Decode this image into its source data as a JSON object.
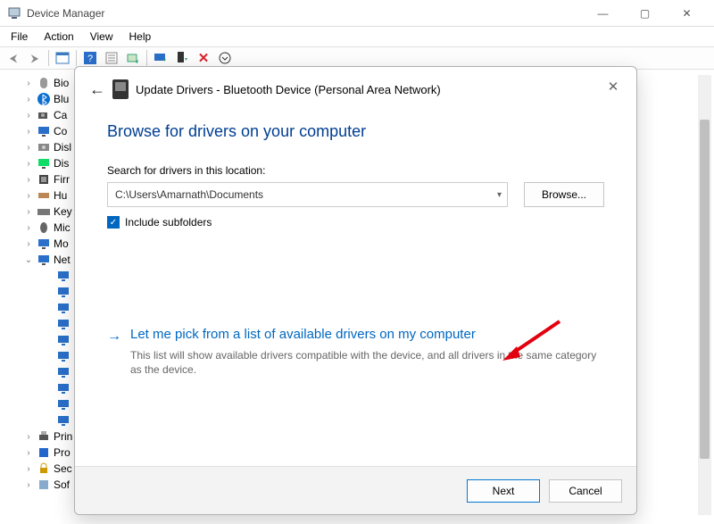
{
  "window": {
    "title": "Device Manager",
    "controls": {
      "min": "—",
      "max": "▢",
      "close": "✕"
    }
  },
  "menu": {
    "items": [
      "File",
      "Action",
      "View",
      "Help"
    ]
  },
  "toolbar": {
    "back": "←",
    "forward": "→",
    "icons": [
      "help",
      "props",
      "scan",
      "update",
      "monitor",
      "enable",
      "disable",
      "uninstall"
    ]
  },
  "tree": {
    "lvl1": [
      {
        "label": "Bio",
        "icon": "finger"
      },
      {
        "label": "Blu",
        "icon": "bt"
      },
      {
        "label": "Ca",
        "icon": "cam"
      },
      {
        "label": "Co",
        "icon": "monitor"
      },
      {
        "label": "Disl",
        "icon": "disk"
      },
      {
        "label": "Dis",
        "icon": "display"
      },
      {
        "label": "Firr",
        "icon": "chip"
      },
      {
        "label": "Hu",
        "icon": "hid"
      },
      {
        "label": "Key",
        "icon": "kbd"
      },
      {
        "label": "Mic",
        "icon": "mouse"
      },
      {
        "label": "Mo",
        "icon": "monitor"
      }
    ],
    "net_label": "Net",
    "net_expanded": true,
    "net_children_count": 10,
    "tail": [
      {
        "label": "Prin",
        "icon": "printer"
      },
      {
        "label": "Pro",
        "icon": "cpu"
      },
      {
        "label": "Sec",
        "icon": "lock"
      },
      {
        "label": "Sof",
        "icon": "soft"
      }
    ]
  },
  "dialog": {
    "title": "Update Drivers - Bluetooth Device (Personal Area Network)",
    "heading": "Browse for drivers on your computer",
    "search_label": "Search for drivers in this location:",
    "path": "C:\\Users\\Amarnath\\Documents",
    "browse": "Browse...",
    "include_subfolders": "Include subfolders",
    "include_checked": true,
    "pick_title": "Let me pick from a list of available drivers on my computer",
    "pick_desc": "This list will show available drivers compatible with the device, and all drivers in the same category as the device.",
    "next": "Next",
    "cancel": "Cancel",
    "close": "✕",
    "back": "←"
  }
}
